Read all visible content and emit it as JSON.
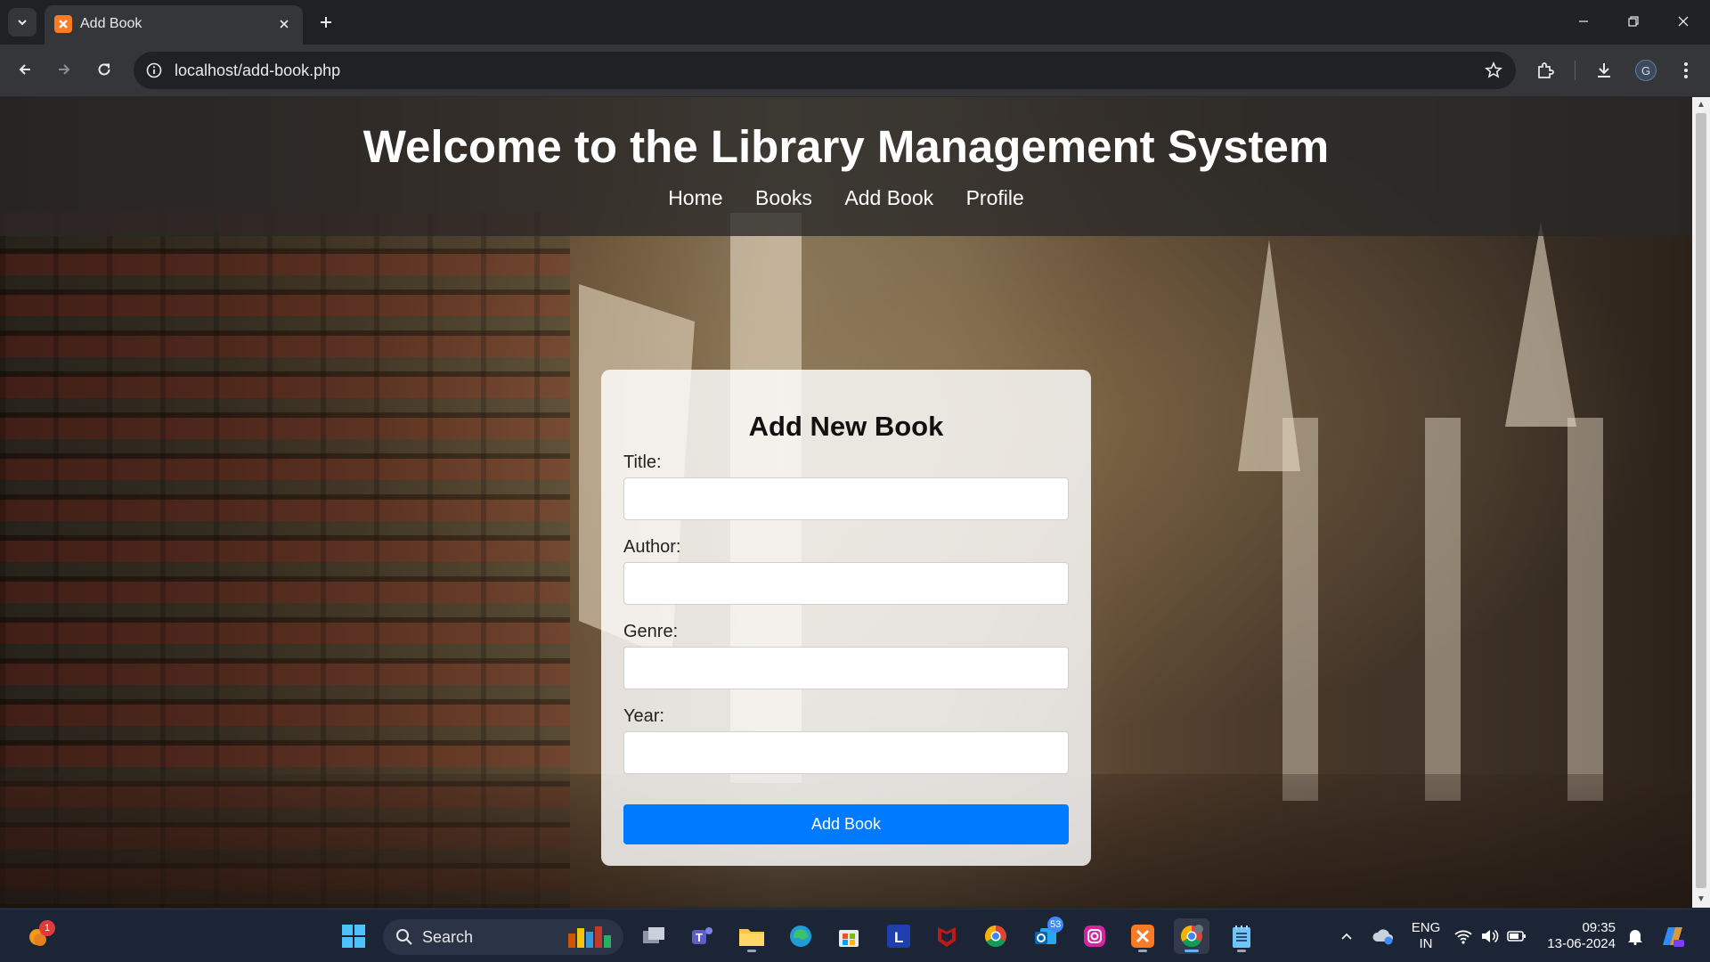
{
  "browser": {
    "tab": {
      "title": "Add Book"
    },
    "address_bar": {
      "url": "localhost/add-book.php"
    },
    "profile_initial": "G"
  },
  "page": {
    "header": {
      "title": "Welcome to the Library Management System",
      "nav": [
        "Home",
        "Books",
        "Add Book",
        "Profile"
      ]
    },
    "form": {
      "heading": "Add New Book",
      "fields": [
        {
          "label": "Title:",
          "value": ""
        },
        {
          "label": "Author:",
          "value": ""
        },
        {
          "label": "Genre:",
          "value": ""
        },
        {
          "label": "Year:",
          "value": ""
        }
      ],
      "submit_label": "Add Book"
    },
    "colors": {
      "primary_button": "#007bff",
      "header_overlay": "#282828"
    }
  },
  "taskbar": {
    "search_label": "Search",
    "weather_badge": "1",
    "mail_badge": "53",
    "language": {
      "line1": "ENG",
      "line2": "IN"
    },
    "clock": {
      "time": "09:35",
      "date": "13-06-2024"
    },
    "pinned_icons": [
      "start-icon",
      "task-view-icon",
      "teams-icon",
      "file-explorer-icon",
      "edge-icon",
      "store-icon",
      "l-app-icon",
      "mcafee-icon",
      "chrome-icon",
      "outlook-icon",
      "instagram-icon",
      "xampp-icon",
      "chrome-profile-icon",
      "notepad-icon"
    ]
  }
}
